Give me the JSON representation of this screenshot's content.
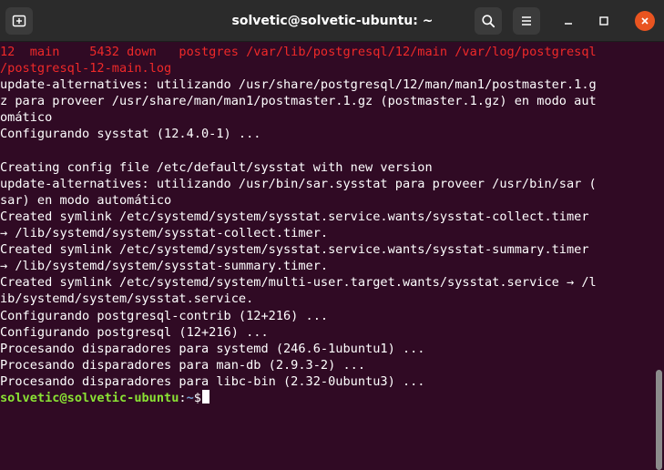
{
  "window": {
    "title": "solvetic@solvetic-ubuntu: ~"
  },
  "colors": {
    "terminal_bg": "#300a24",
    "titlebar_bg": "#2b2b2b",
    "error_text": "#ef2929",
    "prompt_user": "#8ae234",
    "prompt_path": "#729fcf",
    "close_button": "#e95420"
  },
  "icons": {
    "new_tab": "new-tab-icon",
    "search": "search-icon",
    "menu": "hamburger-menu-icon",
    "minimize": "minimize-icon",
    "maximize": "maximize-icon",
    "close": "close-icon"
  },
  "terminal": {
    "lines": [
      "12  main    5432 down   postgres /var/lib/postgresql/12/main /var/log/postgresql",
      "/postgresql-12-main.log",
      "update-alternatives: utilizando /usr/share/postgresql/12/man/man1/postmaster.1.g",
      "z para proveer /usr/share/man/man1/postmaster.1.gz (postmaster.1.gz) en modo aut",
      "omático",
      "Configurando sysstat (12.4.0-1) ...",
      "",
      "Creating config file /etc/default/sysstat with new version",
      "update-alternatives: utilizando /usr/bin/sar.sysstat para proveer /usr/bin/sar (",
      "sar) en modo automático",
      "Created symlink /etc/systemd/system/sysstat.service.wants/sysstat-collect.timer",
      "→ /lib/systemd/system/sysstat-collect.timer.",
      "Created symlink /etc/systemd/system/sysstat.service.wants/sysstat-summary.timer",
      "→ /lib/systemd/system/sysstat-summary.timer.",
      "Created symlink /etc/systemd/system/multi-user.target.wants/sysstat.service → /l",
      "ib/systemd/system/sysstat.service.",
      "Configurando postgresql-contrib (12+216) ...",
      "Configurando postgresql (12+216) ...",
      "Procesando disparadores para systemd (246.6-1ubuntu1) ...",
      "Procesando disparadores para man-db (2.9.3-2) ...",
      "Procesando disparadores para libc-bin (2.32-0ubuntu3) ..."
    ],
    "prompt": {
      "user_host": "solvetic@solvetic-ubuntu",
      "colon": ":",
      "path": "~",
      "symbol": "$"
    }
  }
}
